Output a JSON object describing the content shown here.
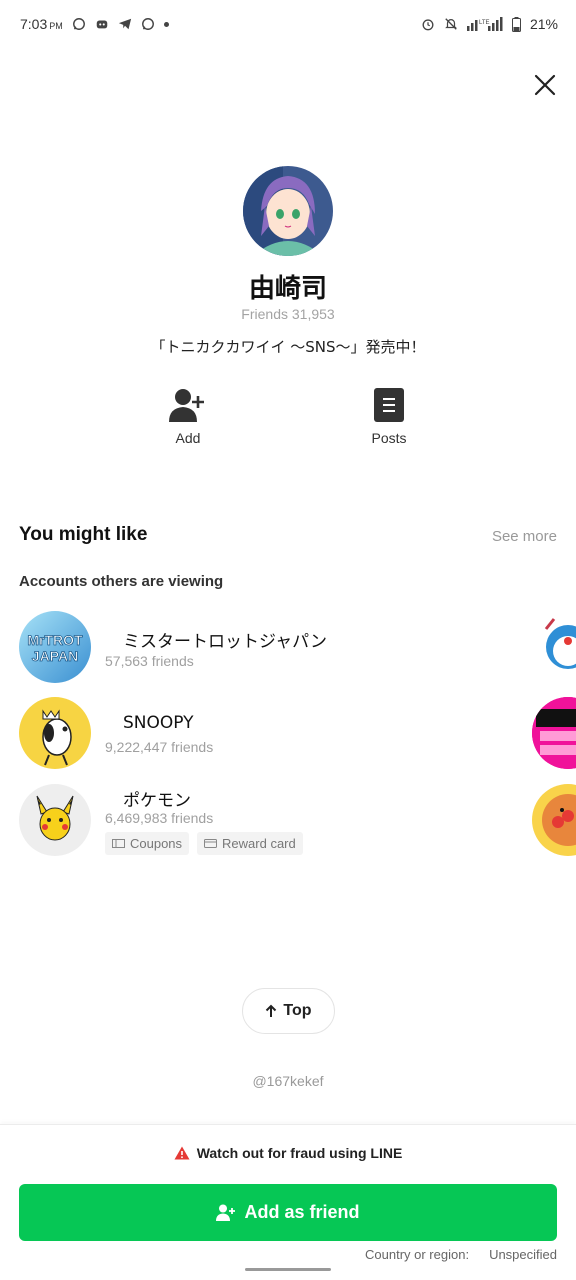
{
  "status_bar": {
    "time": "7:03",
    "ampm": "PM",
    "battery": "21%"
  },
  "profile": {
    "name": "由崎司",
    "friends": "Friends 31,953",
    "status_message": "「トニカクカワイイ 〜SNS〜」発売中！"
  },
  "actions": {
    "add_label": "Add",
    "posts_label": "Posts"
  },
  "recommendations": {
    "title": "You might like",
    "see_more": "See more",
    "subtitle": "Accounts others are viewing",
    "items": [
      {
        "name": "ミスタートロットジャパン",
        "friends": "57,563 friends",
        "logo_text_1": "MrTROT",
        "logo_text_2": "JAPAN"
      },
      {
        "name": "SNOOPY",
        "friends": "9,222,447 friends"
      },
      {
        "name": "ポケモン",
        "friends": "6,469,983 friends",
        "tags": [
          "Coupons",
          "Reward card"
        ]
      }
    ]
  },
  "bottom": {
    "top_button": "Top",
    "handle": "@167kekef",
    "fraud_warning": "Watch out for fraud using LINE",
    "add_friend": "Add as friend",
    "region_label": "Country or region:",
    "region_value": "Unspecified"
  },
  "colors": {
    "accent": "#06c755",
    "warning": "#e53935"
  }
}
